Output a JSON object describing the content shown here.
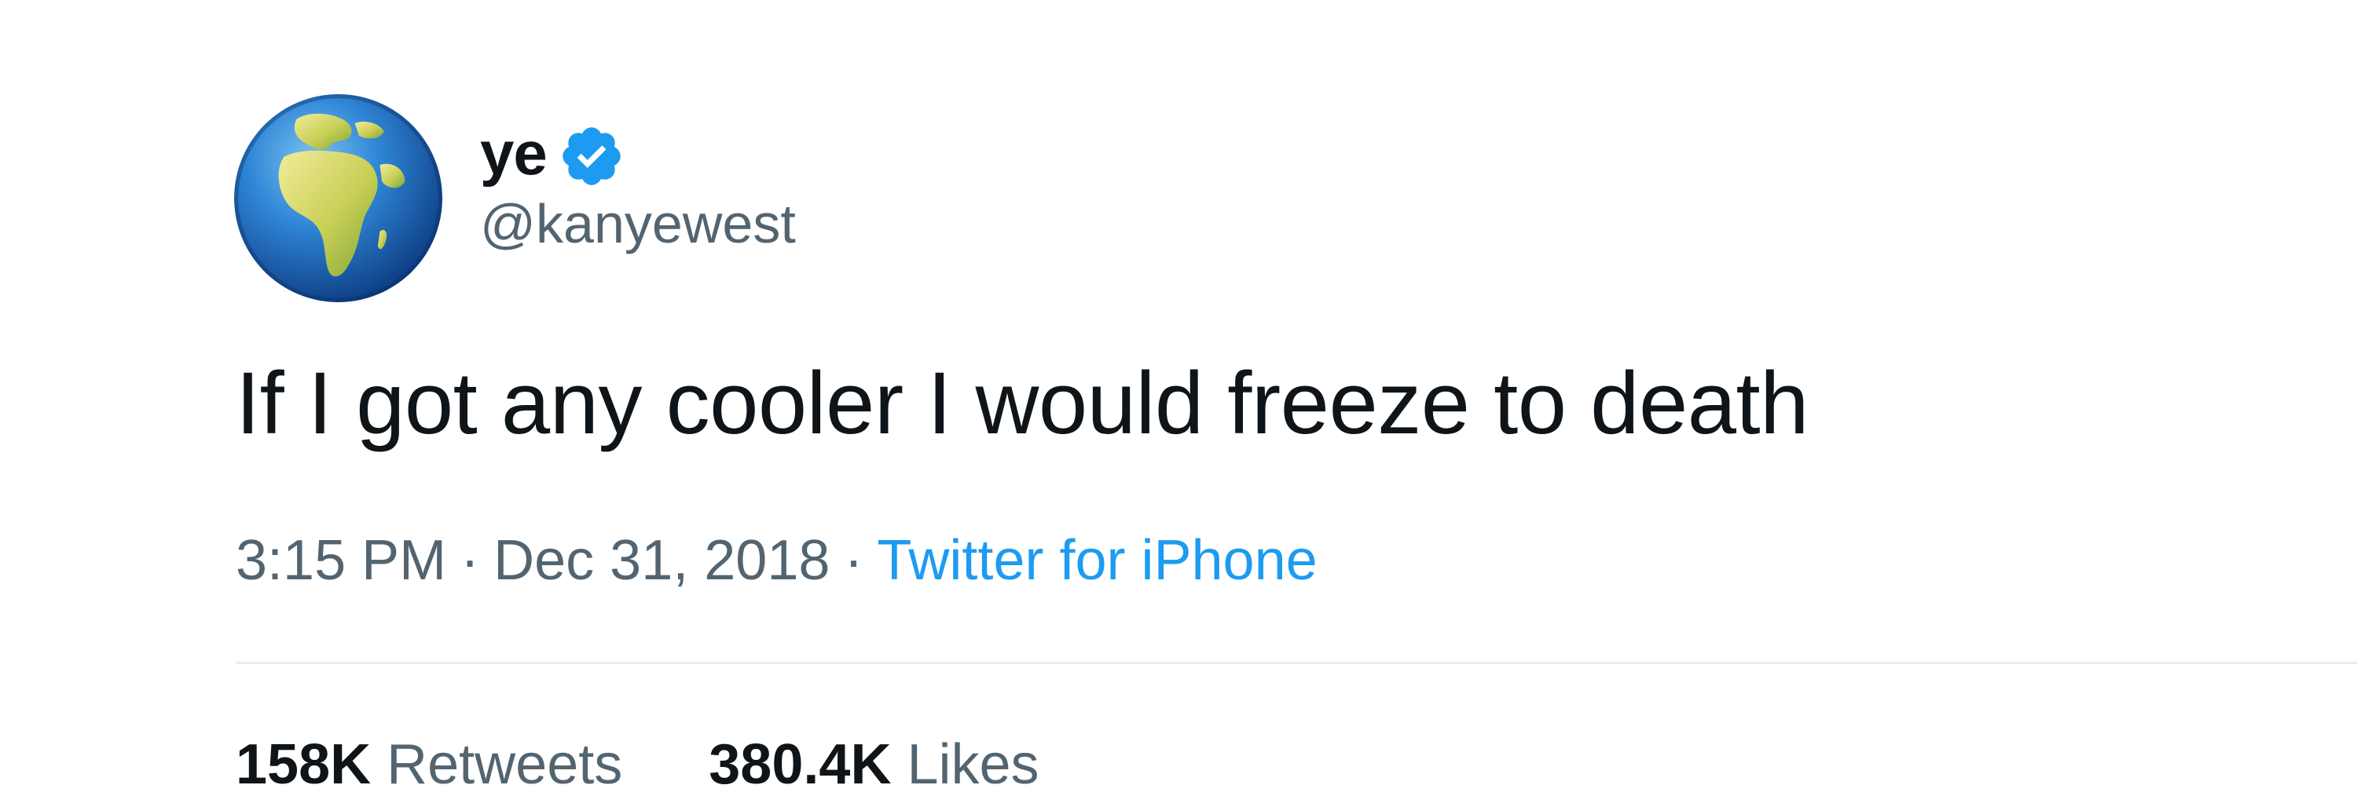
{
  "user": {
    "display_name": "ye",
    "handle": "@kanyewest",
    "verified": true,
    "avatar_icon": "globe-europe-africa-icon",
    "verified_icon": "verified-badge-icon"
  },
  "tweet": {
    "text": "If I got any cooler I would freeze to death",
    "time": "3:15 PM",
    "separator": "·",
    "date": "Dec 31, 2018",
    "source": "Twitter for iPhone"
  },
  "stats": {
    "retweets_count": "158K",
    "retweets_label": "Retweets",
    "likes_count": "380.4K",
    "likes_label": "Likes"
  },
  "colors": {
    "text_primary": "#0f1419",
    "text_secondary": "#536471",
    "link": "#1d9bf0",
    "verified": "#1d9bf0",
    "divider": "#e6ecf0"
  }
}
